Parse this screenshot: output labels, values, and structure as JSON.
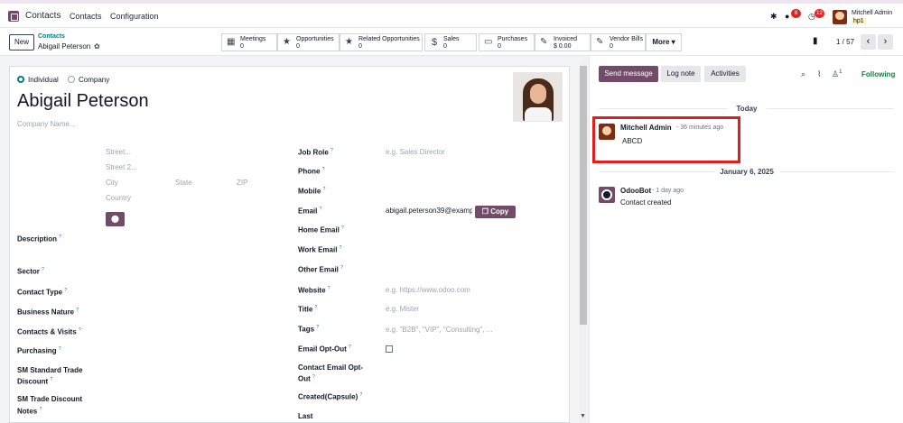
{
  "topbar": {
    "app_name": "Contacts",
    "menu": [
      "Contacts",
      "Configuration"
    ],
    "messages_count": "8",
    "activities_count": "12",
    "user_name": "Mitchell Admin",
    "company": "hp1"
  },
  "control": {
    "new_label": "New",
    "breadcrumb_parent": "Contacts",
    "breadcrumb_current": "Abigail Peterson",
    "smart_buttons": [
      {
        "label": "Meetings",
        "value": "0",
        "icon": "calendar-icon"
      },
      {
        "label": "Opportunities",
        "value": "0",
        "icon": "star-icon"
      },
      {
        "label": "Related Opportunities",
        "value": "0",
        "icon": "star-icon"
      },
      {
        "label": "Sales",
        "value": "0",
        "icon": "dollar-icon"
      },
      {
        "label": "Purchases",
        "value": "0",
        "icon": "credit-card-icon"
      },
      {
        "label": "Invoiced",
        "value": "$ 0.00",
        "icon": "edit-icon"
      },
      {
        "label": "Vendor Bills",
        "value": "0",
        "icon": "edit-icon"
      }
    ],
    "more_label": "More",
    "pager": "1 / 57"
  },
  "form": {
    "type_individual": "Individual",
    "type_company": "Company",
    "name": "Abigail Peterson",
    "company_placeholder": "Company Name...",
    "address": {
      "street": "Street...",
      "street2": "Street 2...",
      "city": "City",
      "state": "State",
      "zip": "ZIP",
      "country": "Country"
    },
    "left_labels": [
      "Description",
      "Sector",
      "Contact Type",
      "Business Nature",
      "Contacts & Visits",
      "Purchasing",
      "SM Standard Trade",
      "Discount",
      "SM Trade Discount",
      "Notes"
    ],
    "right_fields": {
      "job_role_label": "Job Role",
      "job_role_placeholder": "e.g. Sales Director",
      "phone_label": "Phone",
      "mobile_label": "Mobile",
      "email_label": "Email",
      "email_value": "abigail.peterson39@examp",
      "copy_label": "Copy",
      "home_email_label": "Home Email",
      "work_email_label": "Work Email",
      "other_email_label": "Other Email",
      "website_label": "Website",
      "website_placeholder": "e.g. https://www.odoo.com",
      "title_label": "Title",
      "title_placeholder": "e.g. Mister",
      "tags_label": "Tags",
      "tags_placeholder": "e.g. \"B2B\", \"VIP\", \"Consulting\", ...",
      "email_optout_label": "Email Opt-Out",
      "contact_optout_label": "Contact Email Opt-",
      "contact_optout_label2": "Out",
      "created_label": "Created(Capsule)",
      "last_label": "Last"
    }
  },
  "chatter": {
    "send_message": "Send message",
    "log_note": "Log note",
    "activities": "Activities",
    "followers_count": "1",
    "following": "Following",
    "today_label": "Today",
    "messages": [
      {
        "author": "Mitchell Admin",
        "ago": "- 36 minutes ago",
        "body": "ABCD"
      },
      {
        "author": "OdooBot",
        "ago": "- 1 day ago",
        "body": "Contact created"
      }
    ],
    "older_date": "January 6, 2025"
  },
  "colors": {
    "brand": "#714b67",
    "accent": "#017e84",
    "highlight": "#e11d1d",
    "following": "#15803d"
  }
}
